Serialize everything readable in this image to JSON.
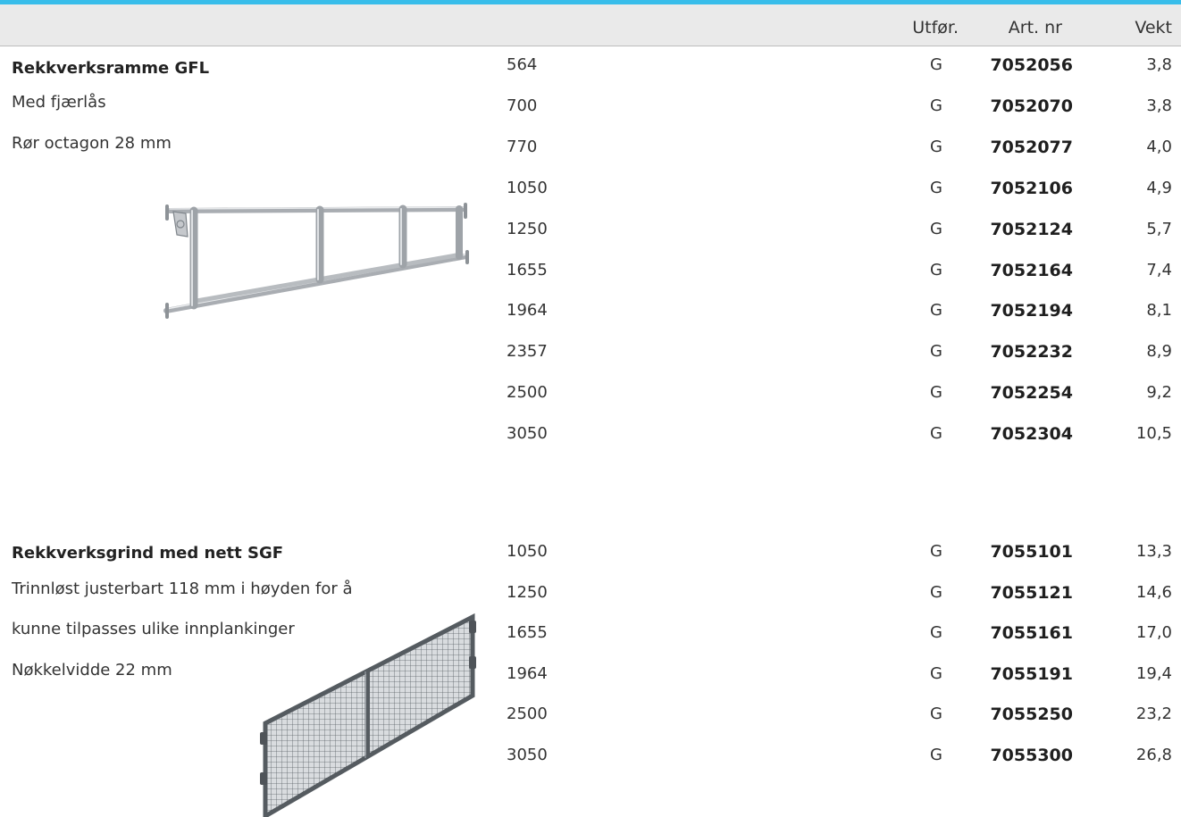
{
  "header": {
    "col_utforelse": "Utfør.",
    "col_artnr": "Art. nr",
    "col_vekt": "Vekt"
  },
  "sections": [
    {
      "title": "Rekkverksramme GFL",
      "lines": [
        "Med fjærlås",
        "Rør octagon 28 mm"
      ],
      "image_icon": "guardrail-frame-icon",
      "rows": [
        {
          "len": "564",
          "utf": "G",
          "art": "7052056",
          "wt": "3,8"
        },
        {
          "len": "700",
          "utf": "G",
          "art": "7052070",
          "wt": "3,8"
        },
        {
          "len": "770",
          "utf": "G",
          "art": "7052077",
          "wt": "4,0"
        },
        {
          "len": "1050",
          "utf": "G",
          "art": "7052106",
          "wt": "4,9"
        },
        {
          "len": "1250",
          "utf": "G",
          "art": "7052124",
          "wt": "5,7"
        },
        {
          "len": "1655",
          "utf": "G",
          "art": "7052164",
          "wt": "7,4"
        },
        {
          "len": "1964",
          "utf": "G",
          "art": "7052194",
          "wt": "8,1"
        },
        {
          "len": "2357",
          "utf": "G",
          "art": "7052232",
          "wt": "8,9"
        },
        {
          "len": "2500",
          "utf": "G",
          "art": "7052254",
          "wt": "9,2"
        },
        {
          "len": "3050",
          "utf": "G",
          "art": "7052304",
          "wt": "10,5"
        }
      ]
    },
    {
      "title": "Rekkverksgrind med nett SGF",
      "lines": [
        "Trinnløst justerbart 118 mm i høyden for å",
        "kunne tilpasses ulike innplankinger",
        "Nøkkelvidde 22 mm"
      ],
      "image_icon": "mesh-guardrail-icon",
      "rows": [
        {
          "len": "1050",
          "utf": "G",
          "art": "7055101",
          "wt": "13,3"
        },
        {
          "len": "1250",
          "utf": "G",
          "art": "7055121",
          "wt": "14,6"
        },
        {
          "len": "1655",
          "utf": "G",
          "art": "7055161",
          "wt": "17,0"
        },
        {
          "len": "1964",
          "utf": "G",
          "art": "7055191",
          "wt": "19,4"
        },
        {
          "len": "2500",
          "utf": "G",
          "art": "7055250",
          "wt": "23,2"
        },
        {
          "len": "3050",
          "utf": "G",
          "art": "7055300",
          "wt": "26,8"
        }
      ]
    }
  ],
  "colors": {
    "accent_bar": "#38bdea",
    "header_bg": "#eaeaea"
  }
}
